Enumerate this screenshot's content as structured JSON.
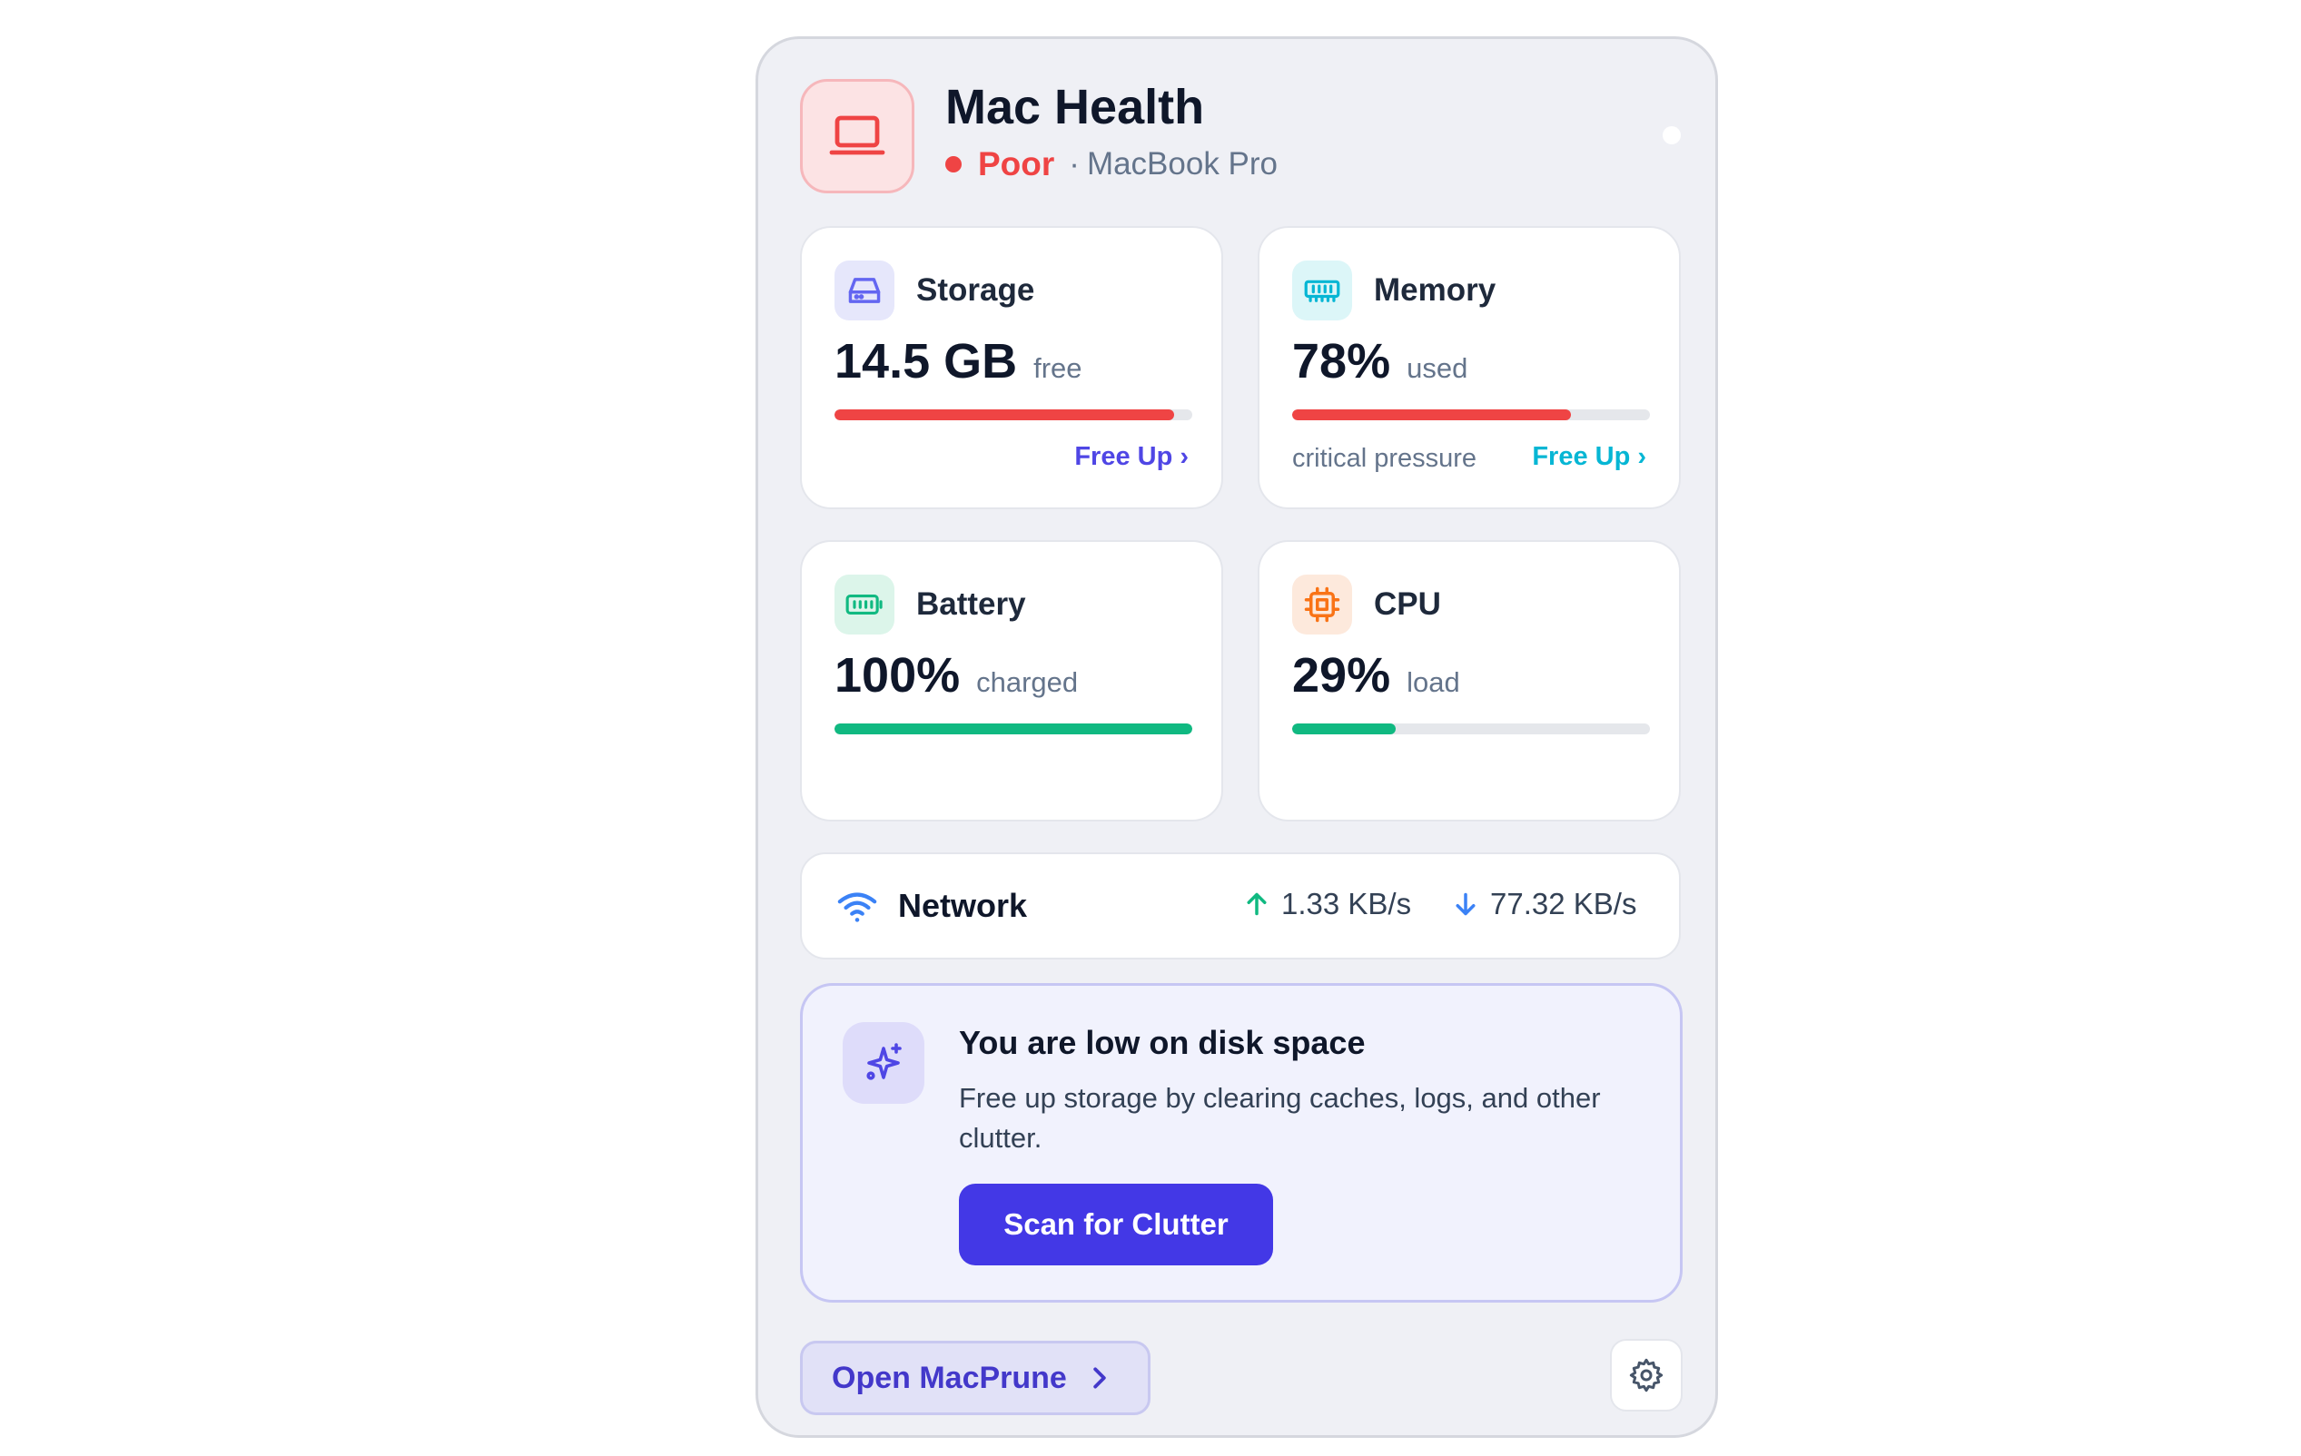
{
  "header": {
    "title": "Mac Health",
    "status": "Poor",
    "separator": "·",
    "device": "MacBook Pro",
    "icon": "laptop-icon"
  },
  "cards": {
    "storage": {
      "label": "Storage",
      "value": "14.5 GB",
      "unit": "free",
      "fill": 0.95,
      "color": "#ef4444",
      "link": "Free Up ›",
      "link_color": "#4f46e5",
      "icon": "hard-drive-icon"
    },
    "memory": {
      "label": "Memory",
      "value": "78%",
      "unit": "used",
      "fill": 0.78,
      "color": "#ef4444",
      "note": "critical pressure",
      "link": "Free Up ›",
      "link_color": "#06b6d4",
      "icon": "memory-chip-icon"
    },
    "battery": {
      "label": "Battery",
      "value": "100%",
      "unit": "charged",
      "fill": 1.0,
      "color": "#10b981",
      "icon": "battery-icon"
    },
    "cpu": {
      "label": "CPU",
      "value": "29%",
      "unit": "load",
      "fill": 0.29,
      "color": "#10b981",
      "icon": "cpu-icon"
    }
  },
  "network": {
    "label": "Network",
    "upload": "1.33 KB/s",
    "download": "77.32 KB/s",
    "icon": "wifi-icon"
  },
  "alert": {
    "title": "You are low on disk space",
    "description": "Free up storage by clearing caches, logs, and other clutter.",
    "button": "Scan for Clutter",
    "icon": "sparkles-icon"
  },
  "footer": {
    "open_button": "Open MacPrune",
    "settings_icon": "gear-icon"
  }
}
